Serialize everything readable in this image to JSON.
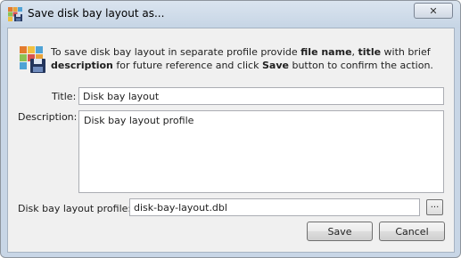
{
  "window": {
    "title": "Save disk bay layout as...",
    "close_glyph": "✕"
  },
  "info": {
    "part1": "To save disk bay layout in separate profile provide ",
    "bold1": "file name",
    "part2": ", ",
    "bold2": "title",
    "part3": " with brief ",
    "bold3": "description",
    "part4": " for future reference and click ",
    "bold4": "Save",
    "part5": " button to confirm the action."
  },
  "form": {
    "title_label": "Title:",
    "title_value": "Disk bay layout",
    "description_label": "Description:",
    "description_value": "Disk bay layout profile",
    "profile_label": "Disk bay layout profile:",
    "profile_value": "disk-bay-layout.dbl",
    "browse_label": "..."
  },
  "buttons": {
    "save_label": "Save",
    "cancel_label": "Cancel"
  },
  "icons": {
    "app": "disk-bay-layout-icon",
    "info": "disk-bay-save-icon"
  }
}
